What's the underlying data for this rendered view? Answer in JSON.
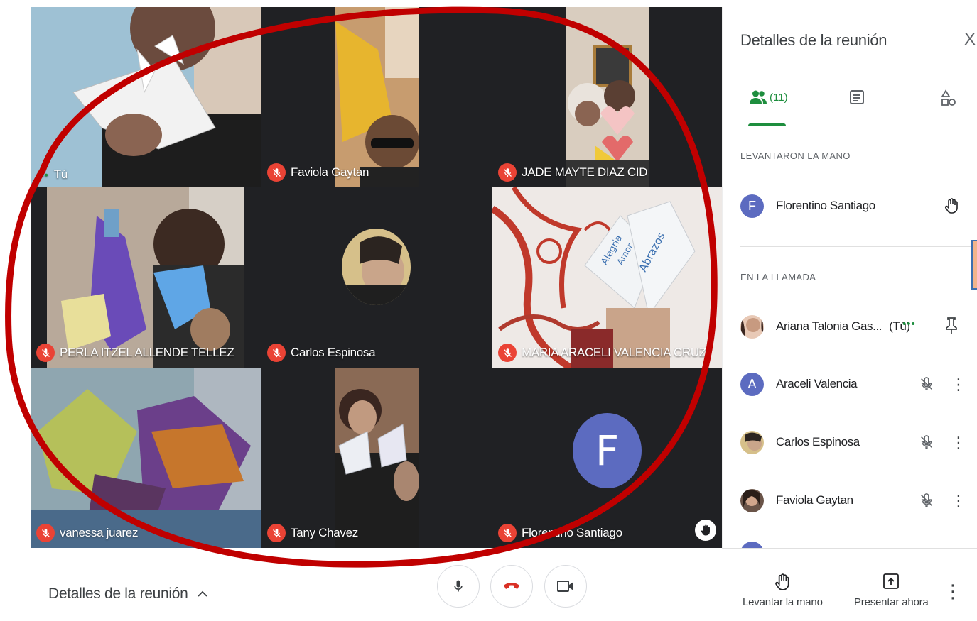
{
  "grid": {
    "tiles": [
      {
        "name": "Tú",
        "muted": false,
        "speaking_dots": "•••"
      },
      {
        "name": "Faviola Gaytan",
        "muted": true
      },
      {
        "name": "JADE MAYTE DIAZ CID",
        "muted": true
      },
      {
        "name": "PERLA ITZEL ALLENDE TELLEZ",
        "muted": true
      },
      {
        "name": "Carlos Espinosa",
        "muted": true
      },
      {
        "name": "MARIA ARACELI VALENCIA CRUZ",
        "muted": true
      },
      {
        "name": "vanessa juarez",
        "muted": true
      },
      {
        "name": "Tany Chavez",
        "muted": true
      },
      {
        "name": "Florentino Santiago",
        "muted": true,
        "avatar_letter": "F",
        "hand_raised": true
      }
    ],
    "video_texts": {
      "heart_line1": "Alegria",
      "heart_line2": "Amor",
      "heart_line3": "Abrazos"
    }
  },
  "bottom_bar": {
    "meeting_details_label": "Detalles de la reunión",
    "raise_hand_label": "Levantar la mano",
    "present_label": "Presentar ahora"
  },
  "panel": {
    "title": "Detalles de la reunión",
    "close_label": "X",
    "people_count": "(11)",
    "section_raised": "LEVANTARON LA MANO",
    "section_in_call": "EN LA LLAMADA",
    "raised": [
      {
        "name": "Florentino Santiago",
        "initial": "F"
      }
    ],
    "in_call": [
      {
        "name": "Ariana Talonia Gas...",
        "you_tag": "(Tú)",
        "speaking_dots": "•••"
      },
      {
        "name": "Araceli Valencia",
        "initial": "A"
      },
      {
        "name": "Carlos Espinosa"
      },
      {
        "name": "Faviola Gaytan"
      }
    ]
  },
  "colors": {
    "accent_green": "#1e8e3e",
    "mute_red": "#ea4335",
    "avatar_purple": "#5c6bc0",
    "annotation_red": "#c00000"
  }
}
